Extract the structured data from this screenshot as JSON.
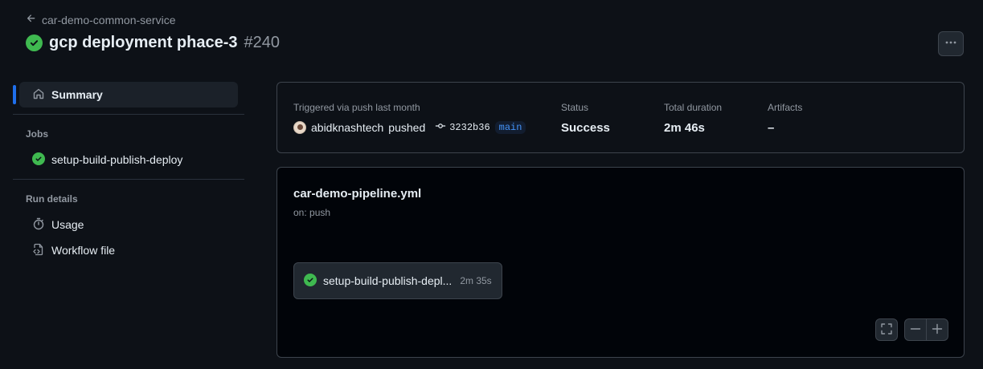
{
  "header": {
    "back_label": "car-demo-common-service",
    "run_title": "gcp deployment phace-3",
    "run_number": "#240"
  },
  "sidebar": {
    "summary_label": "Summary",
    "jobs_heading": "Jobs",
    "jobs": [
      {
        "label": "setup-build-publish-deploy",
        "status": "success"
      }
    ],
    "run_details_heading": "Run details",
    "usage_label": "Usage",
    "workflow_file_label": "Workflow file"
  },
  "summary": {
    "trigger_label": "Triggered via push last month",
    "actor": "abidknashtech",
    "action": "pushed",
    "commit_sha": "3232b36",
    "branch": "main",
    "status_label": "Status",
    "status_value": "Success",
    "duration_label": "Total duration",
    "duration_value": "2m 46s",
    "artifacts_label": "Artifacts",
    "artifacts_value": "–"
  },
  "graph": {
    "workflow_file": "car-demo-pipeline.yml",
    "trigger": "on: push",
    "job_name": "setup-build-publish-depl...",
    "job_duration": "2m 35s"
  },
  "colors": {
    "background": "#0d1117",
    "success": "#238636",
    "accent": "#1f6feb",
    "border": "#3d444d"
  },
  "icons": [
    "arrow-left-icon",
    "check-circle-fill-icon",
    "kebab-horizontal-icon",
    "home-icon",
    "stopwatch-icon",
    "file-code-icon",
    "git-commit-icon",
    "screen-full-icon",
    "dash-icon",
    "plus-icon"
  ]
}
